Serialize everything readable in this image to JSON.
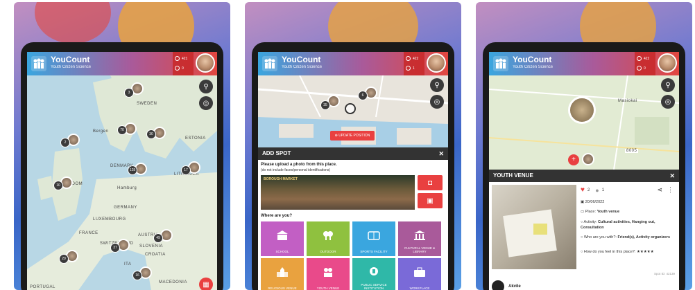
{
  "app": {
    "title": "YouCount",
    "subtitle": "Youth Citizen Science",
    "points": "421",
    "notifications": "0"
  },
  "panel2_header": {
    "points": "422",
    "notifications": "1"
  },
  "panel3_header": {
    "points": "422",
    "notifications": "0"
  },
  "map1": {
    "labels": [
      "SWEDEN",
      "ESTONIA",
      "Bergen",
      "DENMARK",
      "LITHUANIA",
      "KINGDOM",
      "Hamburg",
      "GERMANY",
      "LUXEMBOURG",
      "FRANCE",
      "SWITZERLAND",
      "AUSTRIA",
      "SLOVENIA",
      "CROATIA",
      "ITA",
      "MACEDONIA",
      "PORTUGAL"
    ],
    "clusters": [
      "3",
      "70",
      "30",
      "2",
      "128",
      "17",
      "10",
      "37",
      "20",
      "49",
      "16"
    ]
  },
  "map2": {
    "clusters": [
      "35",
      "6"
    ],
    "update_position": "UPDATE POSITION"
  },
  "add_spot": {
    "title": "ADD SPOT",
    "close": "✕",
    "upload_prompt": "Please upload a photo from this place.",
    "upload_note": "(do not include faces/personal identifications)",
    "photo_sign": "BOROUGH MARKET",
    "where_prompt": "Where are you?",
    "tiles": [
      {
        "label": "SCHOOL",
        "color": "#c25fc4"
      },
      {
        "label": "OUTDOOR",
        "color": "#8fc13f"
      },
      {
        "label": "SPORTS FACILITY",
        "color": "#3aa6df"
      },
      {
        "label": "CULTURAL VENUE & LIBRARY",
        "color": "#a95a9a"
      },
      {
        "label": "RELIGIOUS VENUE",
        "color": "#e9a23f"
      },
      {
        "label": "YOUTH VENUE",
        "color": "#e94a8a"
      },
      {
        "label": "PUBLIC SERVICE INSTITUTION",
        "color": "#2fb8a8"
      },
      {
        "label": "WORKPLACE",
        "color": "#7a6ad8"
      }
    ]
  },
  "map3": {
    "place_label": "Masiokai",
    "road_label": "8005"
  },
  "youth_venue": {
    "title": "YOUTH VENUE",
    "close": "✕",
    "likes": "2",
    "comments": "1",
    "date": "20/06/2022",
    "place_label": "Place:",
    "place_value": "Youth venue",
    "activity_label": "Activity:",
    "activity_value": "Cultural activities, Hanging out, Consultation",
    "with_label": "Who are you with?:",
    "with_value": "Friend(s), Activity organizers",
    "feel_label": "How do you feel in this place?:",
    "feel_value": "★★★★★",
    "spot_id": "Spot ID: 42139",
    "user": "Akvile"
  },
  "colors": {
    "appbar_start": "#3aa6df",
    "appbar_end": "#e2473f",
    "accent_red": "#e94040"
  }
}
